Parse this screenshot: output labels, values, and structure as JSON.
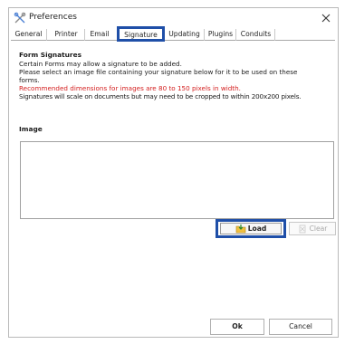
{
  "window": {
    "title": "Preferences",
    "icons": {
      "app": "preferences-icon",
      "close": "close-icon"
    }
  },
  "tabs": [
    {
      "label": "General",
      "active": false
    },
    {
      "label": "Printer",
      "active": false
    },
    {
      "label": "Email",
      "active": false
    },
    {
      "label": "Signature",
      "active": true
    },
    {
      "label": "Updating",
      "active": false
    },
    {
      "label": "Plugins",
      "active": false
    },
    {
      "label": "Conduits",
      "active": false
    }
  ],
  "form_signatures": {
    "heading": "Form Signatures",
    "lines": [
      "Certain Forms may allow a signature to be added.",
      "Please select an image file containing your signature below for it to be used on these",
      "forms.",
      "Recommended dimensions for images are 80 to 150 pixels in width.",
      "Signatures will scale on documents but may need to be cropped to within 200x200 pixels."
    ]
  },
  "image_section": {
    "label": "Image",
    "load_label": "Load",
    "clear_label": "Clear",
    "load_icon": "load-icon",
    "clear_icon": "clear-icon"
  },
  "footer": {
    "ok_label": "Ok",
    "cancel_label": "Cancel"
  },
  "colors": {
    "highlight": "#1f4fa8",
    "warning_text": "#d42020",
    "disabled_text": "#a8a8a8"
  }
}
